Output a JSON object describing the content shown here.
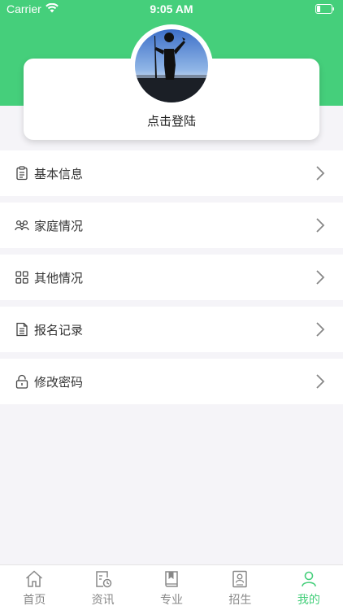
{
  "status_bar": {
    "carrier": "Carrier",
    "time": "9:05 AM"
  },
  "profile": {
    "login_text": "点击登陆"
  },
  "menu": [
    {
      "label": "基本信息",
      "icon": "clipboard-icon"
    },
    {
      "label": "家庭情况",
      "icon": "family-icon"
    },
    {
      "label": "其他情况",
      "icon": "grid-icon"
    },
    {
      "label": "报名记录",
      "icon": "document-icon"
    },
    {
      "label": "修改密码",
      "icon": "lock-icon"
    }
  ],
  "tabbar": {
    "items": [
      {
        "label": "首页",
        "icon": "home-icon",
        "active": false
      },
      {
        "label": "资讯",
        "icon": "news-icon",
        "active": false
      },
      {
        "label": "专业",
        "icon": "book-icon",
        "active": false
      },
      {
        "label": "招生",
        "icon": "admission-icon",
        "active": false
      },
      {
        "label": "我的",
        "icon": "user-icon",
        "active": true
      }
    ]
  },
  "colors": {
    "accent": "#45cf7b",
    "background": "#f5f4f8"
  }
}
